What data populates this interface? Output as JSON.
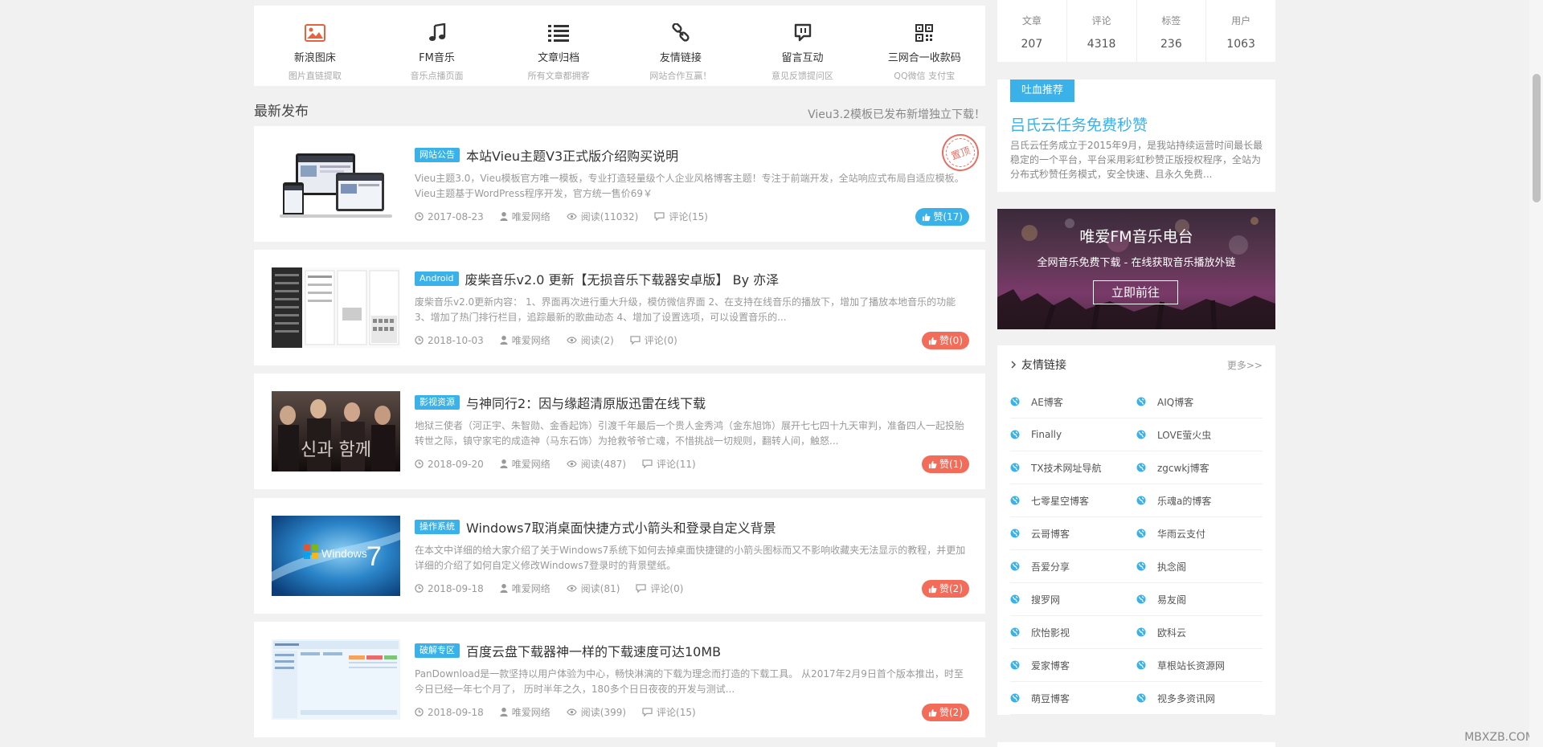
{
  "quicknav": [
    {
      "title": "新浪图床",
      "sub": "图片直链提取",
      "icon": "image-icon"
    },
    {
      "title": "FM音乐",
      "sub": "音乐点播页面",
      "icon": "music-icon"
    },
    {
      "title": "文章归档",
      "sub": "所有文章都拥客",
      "icon": "list-icon"
    },
    {
      "title": "友情链接",
      "sub": "网站合作互赢！",
      "icon": "link-icon"
    },
    {
      "title": "留言互动",
      "sub": "意见反馈提问区",
      "icon": "chat-icon"
    },
    {
      "title": "三网合一收款码",
      "sub": "QQ微信 支付宝",
      "icon": "qrcode-icon"
    }
  ],
  "section": {
    "title": "最新发布",
    "notice": "Vieu3.2模板已发布新增独立下载！"
  },
  "articles": [
    {
      "tag": "网站公告",
      "title": "本站Vieu主题V3正式版介绍购买说明",
      "excerpt": "Vieu主题3.0，Vieu模板官方唯一模板，专业打造轻量级个人企业风格博客主题！专注于前端开发，全站响应式布局自适应模板。Vieu主题基于WordPress程序开发，官方统一售价69￥",
      "date": "2017-08-23",
      "author": "唯爱网络",
      "views": "阅读(11032)",
      "comments": "评论(15)",
      "likes": "赞(17)",
      "sticky": "置顶"
    },
    {
      "tag": "Android",
      "title": "废柴音乐v2.0 更新【无损音乐下载器安卓版】 By 亦泽",
      "excerpt": "废柴音乐v2.0更新内容： 1、界面再次进行重大升级，模仿微信界面 2、在支持在线音乐的播放下，增加了播放本地音乐的功能 3、增加了热门排行栏目，追踪最新的歌曲动态 4、增加了设置选项，可以设置音乐的...",
      "date": "2018-10-03",
      "author": "唯爱网络",
      "views": "阅读(2)",
      "comments": "评论(0)",
      "likes": "赞(0)"
    },
    {
      "tag": "影视资源",
      "title": "与神同行2：因与缘超清原版迅雷在线下载",
      "excerpt": "地狱三使者（河正宇、朱智勋、金香起饰）引渡千年最后一个贵人金秀鸿（金东旭饰）展开七七四十九天审判，准备四人一起投胎转世之际，镇守家宅的成造神（马东石饰）为抢救爷爷亡魂，不惜挑战一切规则，翻转人间，触怒...",
      "date": "2018-09-20",
      "author": "唯爱网络",
      "views": "阅读(487)",
      "comments": "评论(11)",
      "likes": "赞(1)"
    },
    {
      "tag": "操作系统",
      "title": "Windows7取消桌面快捷方式小箭头和登录自定义背景",
      "excerpt": "在本文中详细的给大家介绍了关于Windows7系统下如何去掉桌面快捷键的小箭头图标而又不影响收藏夹无法显示的教程，并更加详细的介绍了如何自定义修改Windows7登录时的背景壁纸。",
      "date": "2018-09-18",
      "author": "唯爱网络",
      "views": "阅读(81)",
      "comments": "评论(0)",
      "likes": "赞(2)"
    },
    {
      "tag": "破解专区",
      "title": "百度云盘下载器神一样的下载速度可达10MB",
      "excerpt": "PanDownload是一款坚持以用户体验为中心，畅快淋漓的下载为理念而打造的下载工具。 从2017年2月9日首个版本推出，时至今日已经一年七个月了， 历时半年之久，180多个日日夜夜的开发与测试...",
      "date": "2018-09-18",
      "author": "唯爱网络",
      "views": "阅读(399)",
      "comments": "评论(15)",
      "likes": "赞(2)"
    }
  ],
  "stats": [
    {
      "label": "文章",
      "value": "207"
    },
    {
      "label": "评论",
      "value": "4318"
    },
    {
      "label": "标签",
      "value": "236"
    },
    {
      "label": "用户",
      "value": "1063"
    }
  ],
  "promo": {
    "tag": "吐血推荐",
    "title": "吕氏云任务免费秒赞",
    "text": "吕氏云任务成立于2015年9月，是我站持续运营时间最长最稳定的一个平台，平台采用彩虹秒赞正版授权程序，全站为分布式秒赞任务模式，安全快速、且永久免费..."
  },
  "banner": {
    "title": "唯爱FM音乐电台",
    "sub": "全网音乐免费下载 - 在线获取音乐播放外链",
    "button": "立即前往"
  },
  "links": {
    "title": "友情链接",
    "more": "更多>>",
    "items": [
      "AE博客",
      "AIQ博客",
      "Finally",
      "LOVE萤火虫",
      "TX技术网址导航",
      "zgcwkj博客",
      "七零星空博客",
      "乐魂a的博客",
      "云哥博客",
      "华雨云支付",
      "吾爱分享",
      "执念阁",
      "搜罗网",
      "易友阁",
      "欣怡影视",
      "欧科云",
      "爱家博客",
      "草根站长资源网",
      "萌豆博客",
      "视多多资讯网"
    ]
  },
  "watermark": "MBXZB.COM",
  "colors": {
    "accent": "#3ab1e8",
    "like_red": "#f36c5a",
    "bg": "#f1f1f1"
  }
}
